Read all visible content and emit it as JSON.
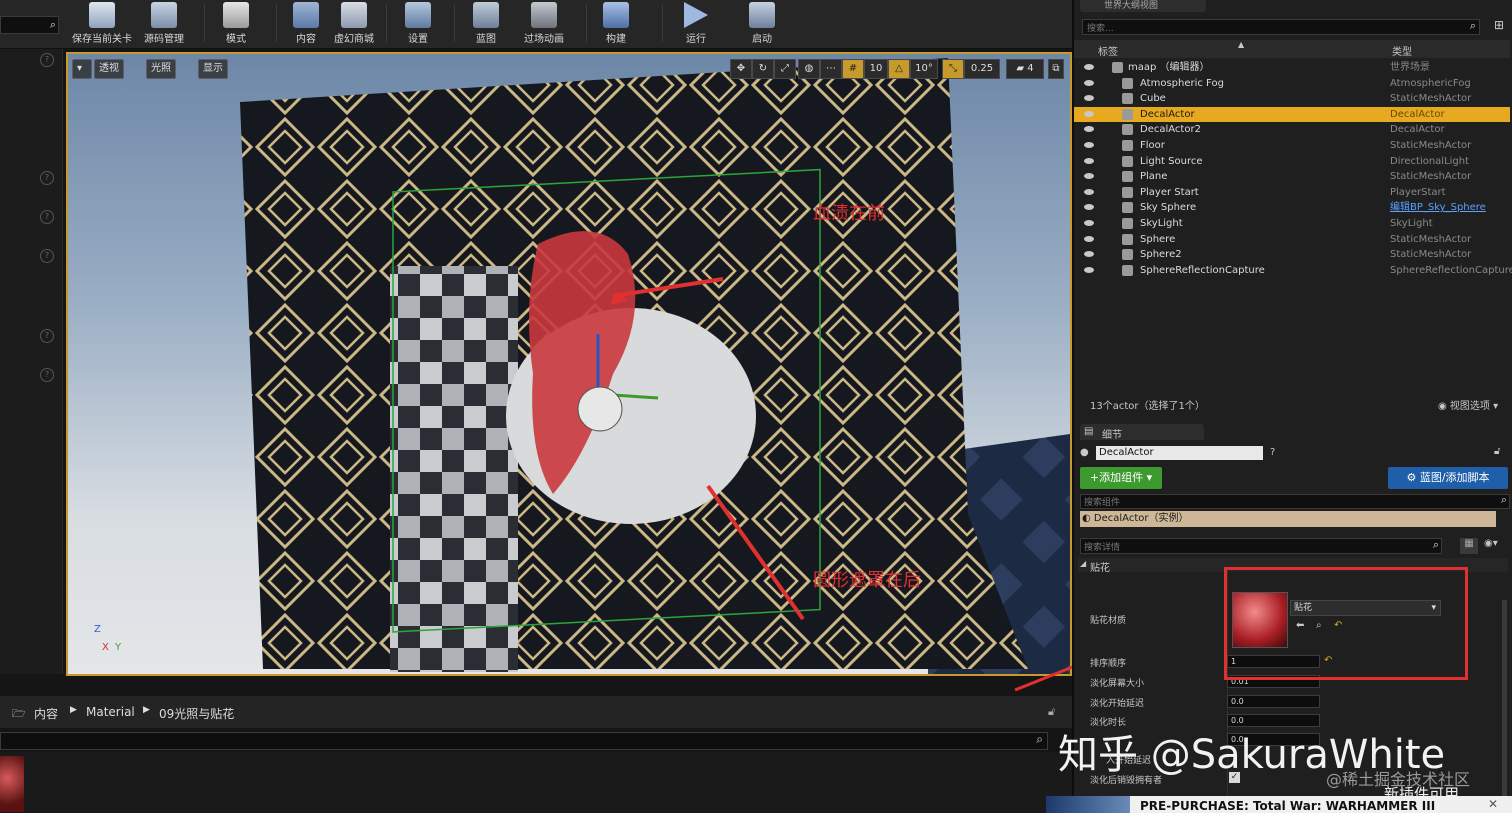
{
  "toolbar": {
    "buttons": [
      {
        "label": "保存当前关卡",
        "icon": "save-icon"
      },
      {
        "label": "源码管理",
        "icon": "source-control-icon"
      },
      {
        "label": "模式",
        "icon": "modes-icon"
      },
      {
        "label": "内容",
        "icon": "content-icon"
      },
      {
        "label": "虚幻商城",
        "icon": "marketplace-icon"
      },
      {
        "label": "设置",
        "icon": "settings-icon"
      },
      {
        "label": "蓝图",
        "icon": "blueprint-icon"
      },
      {
        "label": "过场动画",
        "icon": "cinematics-icon"
      },
      {
        "label": "构建",
        "icon": "build-icon"
      },
      {
        "label": "运行",
        "icon": "play-icon"
      },
      {
        "label": "启动",
        "icon": "launch-icon"
      }
    ]
  },
  "viewport": {
    "perspective_label": "透视",
    "lit_label": "光照",
    "show_label": "显示",
    "grid_snap": "10",
    "rot_snap": "10°",
    "scale_snap": "0.25",
    "camera_speed": "4",
    "annotation_front": "血渍在前",
    "annotation_back": "圆形遮罩在后",
    "axis_labels": {
      "z": "Z",
      "x": "X",
      "y": "Y"
    }
  },
  "outliner": {
    "title": "世界大纲视图",
    "search_placeholder": "搜索...",
    "col_label": "标签",
    "col_type": "类型",
    "rows": [
      {
        "name": "maap （编辑器）",
        "type": "世界场景",
        "icon": "world-icon"
      },
      {
        "name": "Atmospheric Fog",
        "type": "AtmosphericFog",
        "icon": "fog-icon"
      },
      {
        "name": "Cube",
        "type": "StaticMeshActor",
        "icon": "mesh-icon"
      },
      {
        "name": "DecalActor",
        "type": "DecalActor",
        "icon": "decal-icon",
        "selected": true
      },
      {
        "name": "DecalActor2",
        "type": "DecalActor",
        "icon": "decal-icon"
      },
      {
        "name": "Floor",
        "type": "StaticMeshActor",
        "icon": "mesh-icon"
      },
      {
        "name": "Light Source",
        "type": "DirectionalLight",
        "icon": "light-icon"
      },
      {
        "name": "Plane",
        "type": "StaticMeshActor",
        "icon": "mesh-icon"
      },
      {
        "name": "Player Start",
        "type": "PlayerStart",
        "icon": "player-start-icon"
      },
      {
        "name": "Sky Sphere",
        "type": "编辑BP_Sky_Sphere",
        "icon": "sphere-icon",
        "type_is_link": true
      },
      {
        "name": "SkyLight",
        "type": "SkyLight",
        "icon": "skylight-icon"
      },
      {
        "name": "Sphere",
        "type": "StaticMeshActor",
        "icon": "mesh-icon"
      },
      {
        "name": "Sphere2",
        "type": "StaticMeshActor",
        "icon": "mesh-icon"
      },
      {
        "name": "SphereReflectionCapture",
        "type": "SphereReflectionCapture",
        "icon": "reflection-icon"
      }
    ],
    "footer_count": "13个actor（选择了1个）",
    "view_options": "视图选项"
  },
  "details": {
    "tab_title": "细节",
    "actor_name": "DecalActor",
    "add_component": "+添加组件",
    "blueprint_button": "蓝图/添加脚本",
    "search_components_placeholder": "搜索组件",
    "instance_label": "DecalActor（实例）",
    "search_details_placeholder": "搜索详情",
    "section_title": "贴花",
    "material_label": "贴花材质",
    "material_value": "贴花",
    "sort_order_label": "排序顺序",
    "sort_order_value": "1",
    "fade_screen_size_label": "淡化屏幕大小",
    "fade_screen_size_value": "0.01",
    "fade_start_delay_label": "淡化开始延迟",
    "fade_start_delay_value": "0.0",
    "fade_duration_label": "淡化时长",
    "fade_duration_value": "0.0",
    "extra_value_1": "0.0",
    "extra_label_2": "入开始延迟",
    "destroy_owner_label": "淡化后销毁拥有者"
  },
  "content_browser": {
    "breadcrumb": [
      "内容",
      "Material",
      "09光照与贴花"
    ]
  },
  "overlays": {
    "watermark_zhihu": "知乎 @SakuraWhite",
    "watermark_juejin": "@稀土掘金技术社区",
    "promo_text": "PRE-PURCHASE: Total War: WARHAMMER III",
    "plugin_text": "新插件可用"
  },
  "colors": {
    "selection": "#e6a91f",
    "annotation_red": "#e03030",
    "add_button_green": "#3c9a2e",
    "blueprint_button_blue": "#1f5ea8",
    "viewport_border": "#c79a2b"
  }
}
